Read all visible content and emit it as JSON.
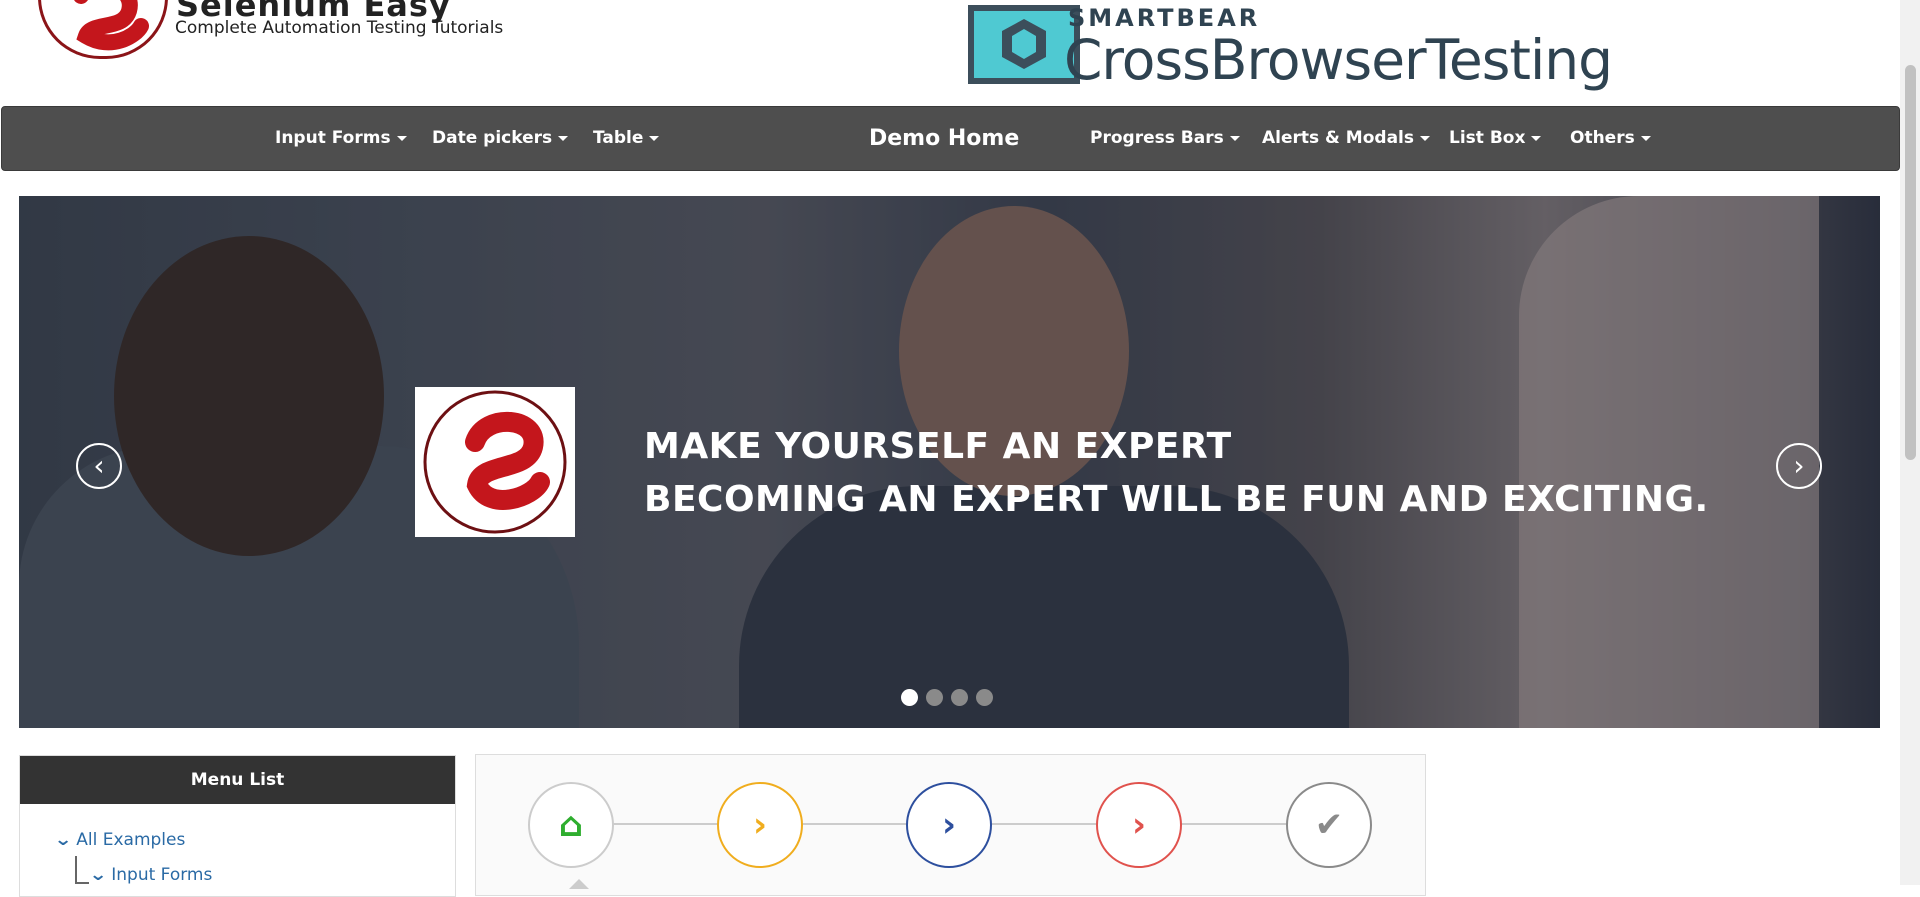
{
  "header": {
    "brand_name": "Selenium Easy",
    "tagline": "Complete Automation Testing Tutorials",
    "sponsor_small": "SMARTBEAR",
    "sponsor_big": "CrossBrowserTesting"
  },
  "nav": {
    "items": [
      {
        "label": "Input Forms"
      },
      {
        "label": "Date pickers"
      },
      {
        "label": "Table"
      },
      {
        "label": "Demo Home"
      },
      {
        "label": "Progress Bars"
      },
      {
        "label": "Alerts & Modals"
      },
      {
        "label": "List Box"
      },
      {
        "label": "Others"
      }
    ]
  },
  "carousel": {
    "line1": "MAKE YOURSELF AN EXPERT",
    "line2": "BECOMING AN EXPERT WILL BE FUN AND EXCITING.",
    "prev_icon": "chevron-left-icon",
    "next_icon": "chevron-right-icon",
    "slide_count": 4,
    "active_slide": 1
  },
  "menu": {
    "title": "Menu List",
    "items": [
      {
        "label": "All Examples"
      },
      {
        "label": "Input Forms"
      }
    ]
  },
  "steps": [
    {
      "icon": "home-icon",
      "color": "#2fae2f"
    },
    {
      "icon": "chevron-right-icon",
      "color": "#f0ad1e"
    },
    {
      "icon": "chevron-right-icon",
      "color": "#2d4f9e"
    },
    {
      "icon": "chevron-right-icon",
      "color": "#e0524d"
    },
    {
      "icon": "check-icon",
      "color": "#8a8a8a"
    }
  ],
  "colors": {
    "navbar": "#4e4e4e",
    "link": "#2a6aa5",
    "brand_red": "#c4161c"
  }
}
